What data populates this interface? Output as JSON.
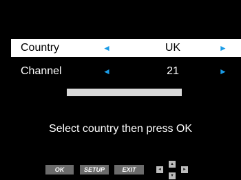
{
  "settings": {
    "country": {
      "label": "Country",
      "value": "UK",
      "left_arrow": "◄",
      "right_arrow": "►"
    },
    "channel": {
      "label": "Channel",
      "value": "21",
      "left_arrow": "◄",
      "right_arrow": "►"
    }
  },
  "progress": {
    "fraction": 1.0
  },
  "instruction": "Select country then press OK",
  "buttons": {
    "ok": "OK",
    "setup": "SETUP",
    "exit": "EXIT"
  },
  "dpad": {
    "left": "◄",
    "up": "▲",
    "down": "▼",
    "right": "►"
  },
  "colors": {
    "accent": "#1a9be6",
    "selected_row": "#ffffff",
    "background": "#000000",
    "button": "#6b6b6b"
  }
}
